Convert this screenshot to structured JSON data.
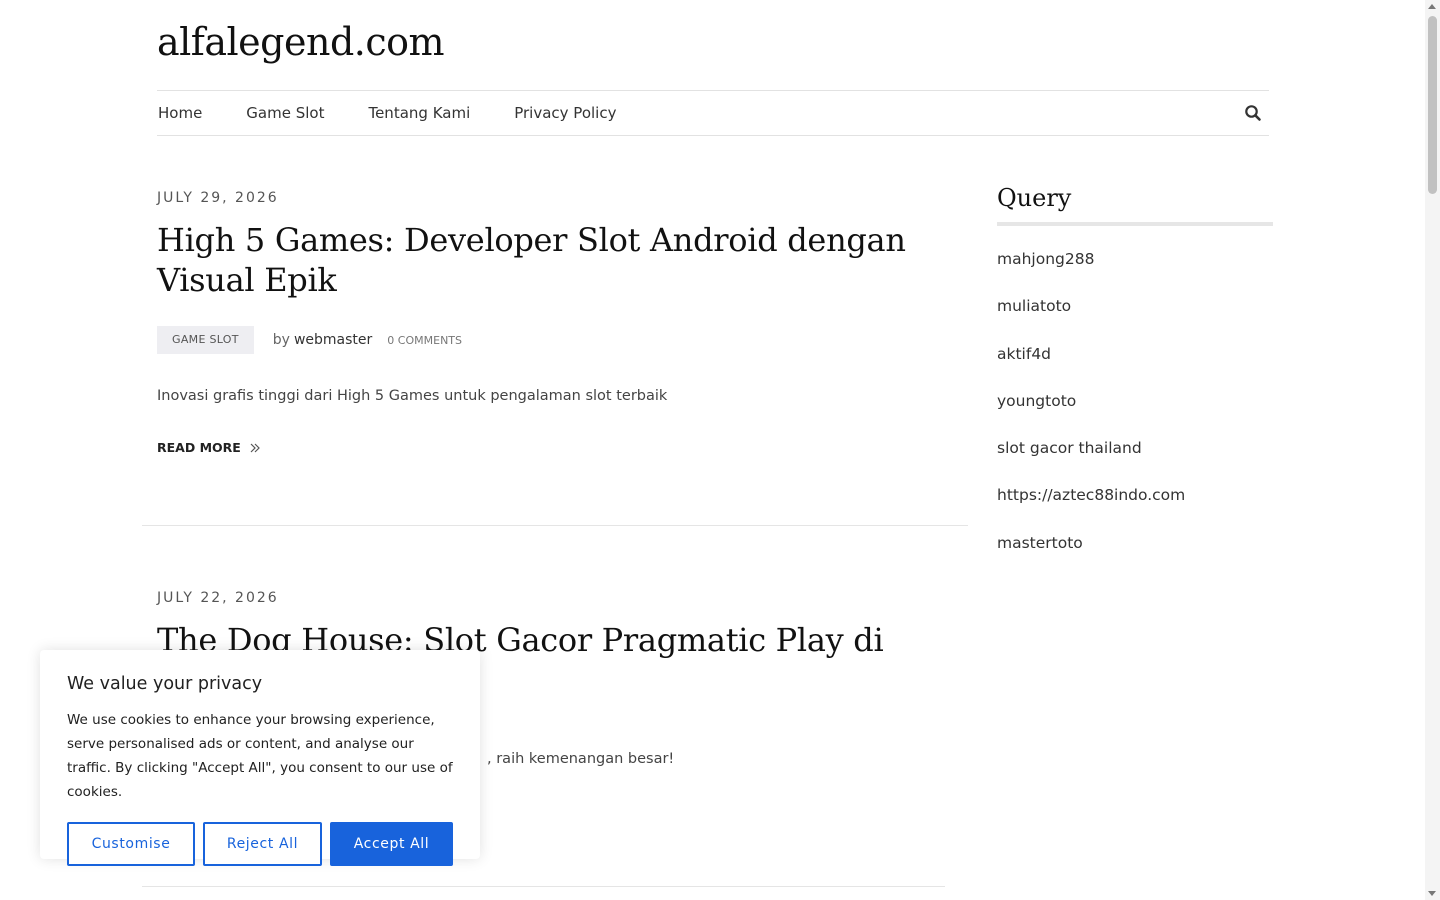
{
  "site": {
    "title": "alfalegend.com"
  },
  "nav": {
    "items": [
      "Home",
      "Game Slot",
      "Tentang Kami",
      "Privacy Policy"
    ],
    "search_icon": "search-icon"
  },
  "posts": [
    {
      "date": "JULY 29, 2026",
      "title": "High 5 Games: Developer Slot Android dengan Visual Epik",
      "category": "GAME SLOT",
      "by": "by",
      "author": "webmaster",
      "comments": "0 COMMENTS",
      "excerpt": "Inovasi grafis tinggi dari High 5 Games untuk pengalaman slot terbaik",
      "read_more": "READ MORE"
    },
    {
      "date": "JULY 22, 2026",
      "title": "The Dog House: Slot Gacor Pragmatic Play di Android",
      "excerpt": ", raih kemenangan besar!"
    }
  ],
  "sidebar": {
    "widget_title": "Query",
    "items": [
      "mahjong288",
      "muliatoto",
      "aktif4d",
      "youngtoto",
      "slot gacor thailand",
      "https://aztec88indo.com",
      "mastertoto"
    ]
  },
  "cookie": {
    "title": "We value your privacy",
    "text": "We use cookies to enhance your browsing experience, serve personalised ads or content, and analyse our traffic. By clicking \"Accept All\", you consent to our use of cookies.",
    "customise": "Customise",
    "reject": "Reject All",
    "accept": "Accept All",
    "accent": "#1863dc"
  }
}
